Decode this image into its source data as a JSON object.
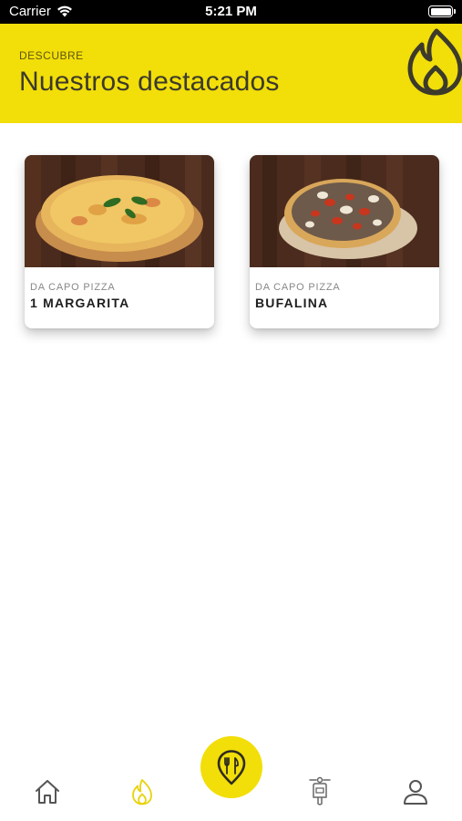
{
  "status_bar": {
    "carrier": "Carrier",
    "time": "5:21 PM",
    "battery_level": 1.0
  },
  "header": {
    "kicker": "DESCUBRE",
    "title": "Nuestros destacados",
    "icon": "flame-icon"
  },
  "featured": [
    {
      "restaurant": "DA CAPO PIZZA",
      "name": "1 MARGARITA"
    },
    {
      "restaurant": "DA CAPO PIZZA",
      "name": "BUFALINA"
    }
  ],
  "tabbar": {
    "items": [
      "home-icon",
      "flame-icon",
      "restaurant-pin-icon",
      "delivery-scooter-icon",
      "profile-icon"
    ],
    "active": "flame-icon"
  },
  "colors": {
    "accent": "#f2de09",
    "header_text": "#3c3a2b",
    "icon_gray": "#555555"
  }
}
